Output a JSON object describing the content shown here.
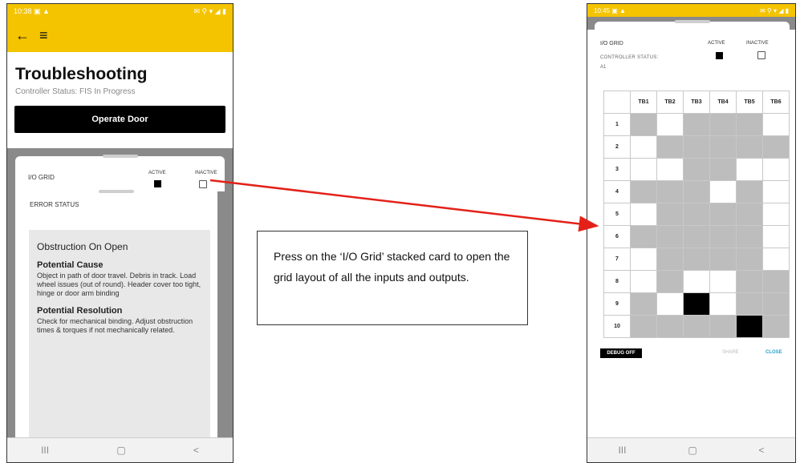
{
  "left_phone": {
    "status_time": "10:38",
    "status_icons_left": "▣ ▲",
    "status_icons_right": "✉ ⚲ ▾ ◢ ▮",
    "back_icon": "←",
    "menu_icon": "≡",
    "title": "Troubleshooting",
    "controller_status": "Controller Status: FIS In Progress",
    "operate_button": "Operate Door",
    "io_grid": {
      "label": "I/O GRID",
      "active_label": "ACTIVE",
      "inactive_label": "INACTIVE"
    },
    "error_status": {
      "label": "ERROR STATUS",
      "title": "Obstruction On Open",
      "cause_heading": "Potential Cause",
      "cause_text": "Object in path of door travel. Debris in track. Load wheel issues (out of round). Header cover too tight, hinge or door arm binding",
      "resolution_heading": "Potential Resolution",
      "resolution_text": "Check for mechanical binding. Adjust obstruction times & torques if not mechanically related."
    },
    "nav": {
      "recent": "III",
      "home": "▢",
      "back": "<"
    }
  },
  "callout": {
    "text": "Press on the ‘I/O Grid’ stacked card to open the grid layout of all the inputs and outputs."
  },
  "right_phone": {
    "status_time": "10:45",
    "status_icons_left": "▣ ▲",
    "status_icons_right": "✉ ⚲ ▾ ◢ ▮",
    "io_grid_label": "I/O GRID",
    "controller_status_label": "CONTROLLER STATUS:",
    "controller_status_value": "A1",
    "active_label": "ACTIVE",
    "inactive_label": "INACTIVE",
    "columns": [
      "TB1",
      "TB2",
      "TB3",
      "TB4",
      "TB5",
      "TB6"
    ],
    "rows": [
      {
        "label": "1",
        "cells": [
          1,
          0,
          1,
          1,
          1,
          0
        ]
      },
      {
        "label": "2",
        "cells": [
          0,
          1,
          1,
          1,
          1,
          1
        ]
      },
      {
        "label": "3",
        "cells": [
          0,
          0,
          1,
          1,
          0,
          0
        ]
      },
      {
        "label": "4",
        "cells": [
          1,
          1,
          1,
          0,
          1,
          0
        ]
      },
      {
        "label": "5",
        "cells": [
          0,
          1,
          1,
          1,
          1,
          0
        ]
      },
      {
        "label": "6",
        "cells": [
          1,
          1,
          1,
          1,
          1,
          0
        ]
      },
      {
        "label": "7",
        "cells": [
          0,
          1,
          1,
          1,
          1,
          0
        ]
      },
      {
        "label": "8",
        "cells": [
          0,
          1,
          0,
          0,
          1,
          1
        ]
      },
      {
        "label": "9",
        "cells": [
          1,
          0,
          2,
          0,
          1,
          1
        ]
      },
      {
        "label": "10",
        "cells": [
          1,
          1,
          1,
          1,
          2,
          1
        ]
      }
    ],
    "debug_button": "DEBUG OFF",
    "share_label": "SHARE",
    "close_label": "CLOSE",
    "nav": {
      "recent": "III",
      "home": "▢",
      "back": "<"
    }
  },
  "colors": {
    "brand_yellow": "#f5c400",
    "arrow_red": "#e32119",
    "active_cell": "#bdbdbd",
    "highlight_cell": "#000000",
    "close_link": "#2aa3c9"
  }
}
